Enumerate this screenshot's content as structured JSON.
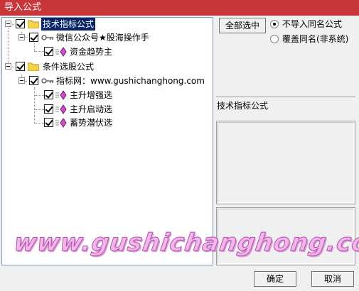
{
  "window": {
    "title": "导入公式"
  },
  "tree": {
    "groups": [
      {
        "label": "技术指标公式",
        "child": {
          "label": "微信公众号★股海操作手",
          "items": [
            "资金趋势主"
          ]
        }
      },
      {
        "label": "条件选股公式",
        "child": {
          "label": "指标网：www.gushichanghong.com",
          "items": [
            "主升增强选",
            "主升启动选",
            "蓄势潜伏选"
          ]
        }
      }
    ]
  },
  "right": {
    "select_all_label": "全部选中",
    "options": [
      {
        "label": "不导入同名公式",
        "selected": true
      },
      {
        "label": "覆盖同名(非系统)",
        "selected": false
      }
    ],
    "description_title": "技术指标公式"
  },
  "footer": {
    "ok_label": "确定",
    "cancel_label": "取消"
  },
  "watermark": {
    "text": "www.gushichanghong.com"
  },
  "colors": {
    "title_bar": "#c8363a",
    "selection": "#0a246a"
  }
}
